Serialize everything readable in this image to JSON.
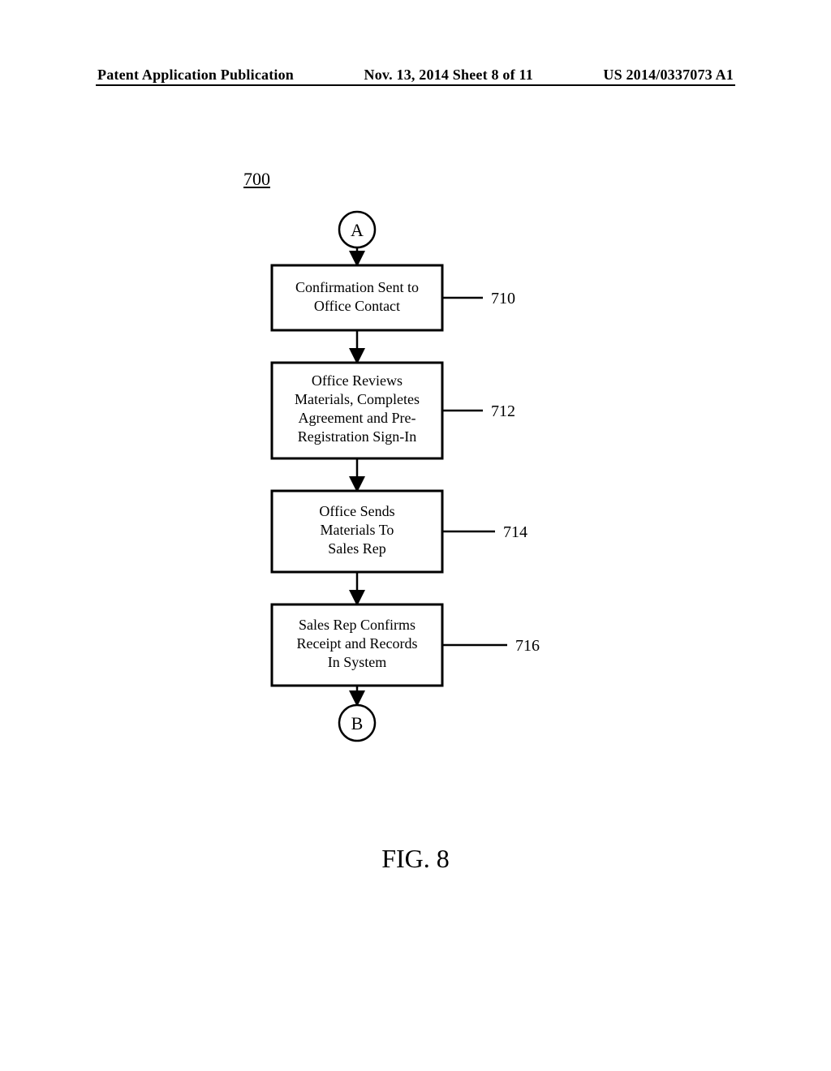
{
  "header": {
    "left": "Patent Application Publication",
    "center": "Nov. 13, 2014  Sheet 8 of 11",
    "right": "US 2014/0337073 A1"
  },
  "figure_ref": "700",
  "connectors": {
    "start": "A",
    "end": "B"
  },
  "steps": [
    {
      "ref": "710",
      "lines": [
        "Confirmation Sent to",
        "Office Contact"
      ]
    },
    {
      "ref": "712",
      "lines": [
        "Office Reviews",
        "Materials, Completes",
        "Agreement and Pre-",
        "Registration Sign-In"
      ]
    },
    {
      "ref": "714",
      "lines": [
        "Office Sends",
        "Materials To",
        "Sales Rep"
      ]
    },
    {
      "ref": "716",
      "lines": [
        "Sales Rep Confirms",
        "Receipt and Records",
        "In System"
      ]
    }
  ],
  "caption": "FIG. 8"
}
